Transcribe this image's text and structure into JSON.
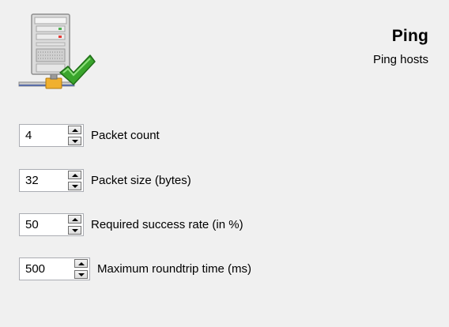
{
  "header": {
    "title": "Ping",
    "subtitle": "Ping hosts",
    "icon": "server-check-icon"
  },
  "settings": [
    {
      "value": "4",
      "label": "Packet count"
    },
    {
      "value": "32",
      "label": "Packet size (bytes)"
    },
    {
      "value": "50",
      "label": "Required success rate (in %)"
    },
    {
      "value": "500",
      "label": "Maximum roundtrip time (ms)"
    }
  ],
  "colors": {
    "background": "#f0f0f0",
    "check_green": "#3aa52c",
    "connector_orange": "#f0b02e"
  }
}
